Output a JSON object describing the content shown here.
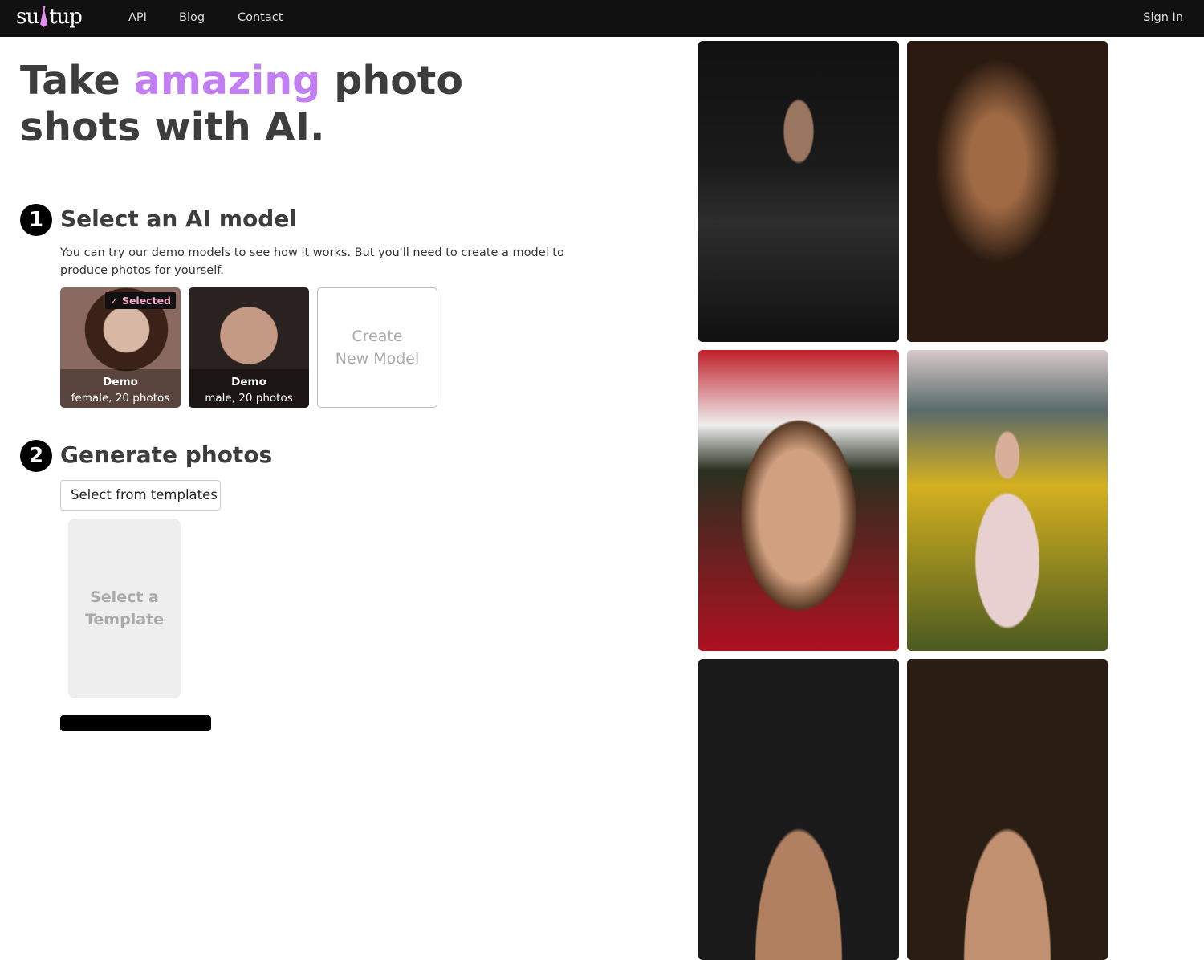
{
  "nav": {
    "logo": "suitup",
    "links": [
      "API",
      "Blog",
      "Contact"
    ],
    "sign_in": "Sign In"
  },
  "hero": {
    "title_before": "Take ",
    "title_accent": "amazing",
    "title_after": " photo shots with AI.",
    "accent_color": "#c27ef2"
  },
  "step1": {
    "number": "1",
    "title": "Select an AI model",
    "description": "You can try our demo models to see how it works. But you'll need to create a model to produce photos for yourself.",
    "models": [
      {
        "name": "Demo",
        "detail": "female, 20 photos",
        "selected": true,
        "badge": "✓ Selected"
      },
      {
        "name": "Demo",
        "detail": "male, 20 photos",
        "selected": false
      }
    ],
    "create_label": "Create New Model"
  },
  "step2": {
    "number": "2",
    "title": "Generate photos",
    "template_select": "Select from templates",
    "template_placeholder": "Select a Template"
  }
}
